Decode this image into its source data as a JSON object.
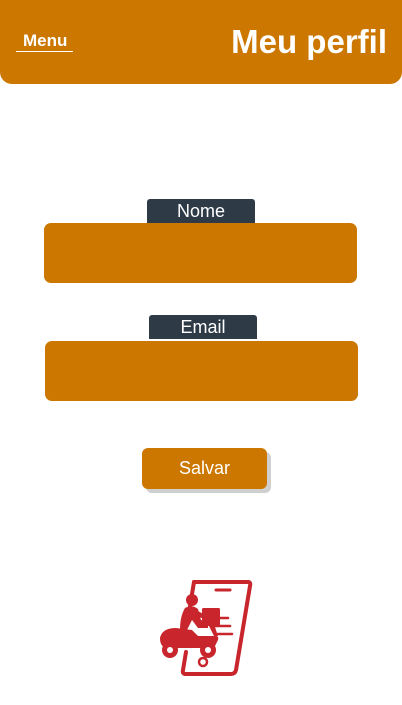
{
  "header": {
    "menu_label": "Menu",
    "title": "Meu perfil"
  },
  "form": {
    "name_label": "Nome",
    "name_value": "",
    "email_label": "Email",
    "email_value": "",
    "save_label": "Salvar"
  },
  "logo": {
    "icon": "delivery-scooter-phone-icon"
  },
  "colors": {
    "accent": "#cc7700",
    "label_bg": "#2e3b47",
    "logo": "#c8262c"
  }
}
